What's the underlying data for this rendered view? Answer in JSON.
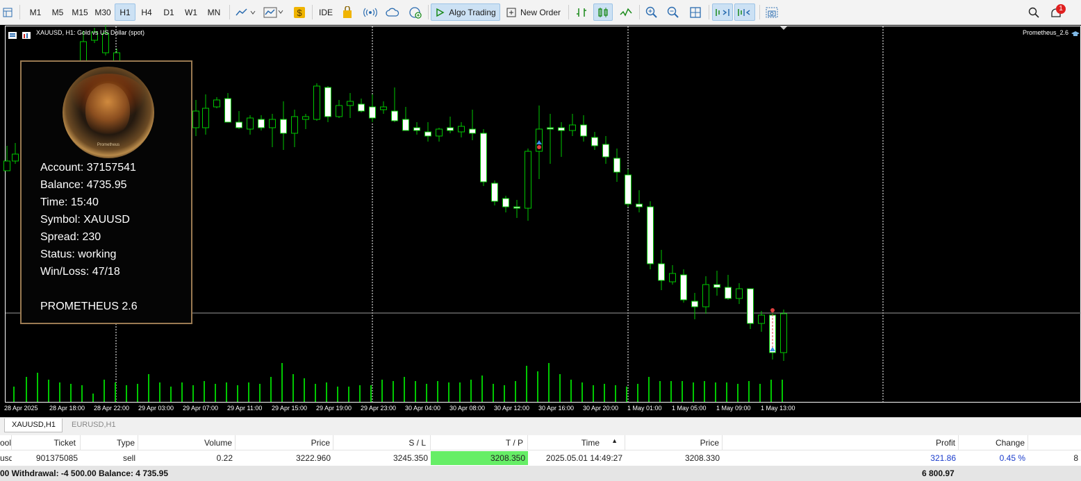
{
  "toolbar": {
    "timeframes": [
      "M1",
      "M5",
      "M15",
      "M30",
      "H1",
      "H4",
      "D1",
      "W1",
      "MN"
    ],
    "active_timeframe": "H1",
    "ide_label": "IDE",
    "algo_trading_label": "Algo Trading",
    "new_order_label": "New Order",
    "notification_count": "1"
  },
  "chart": {
    "title": "XAUUSD, H1:  Gold vs US Dollar (spot)",
    "ea_label": "Prometheus_2.6",
    "x_labels": [
      "28 Apr 2025",
      "28 Apr 18:00",
      "28 Apr 22:00",
      "29 Apr 03:00",
      "29 Apr 07:00",
      "29 Apr 11:00",
      "29 Apr 15:00",
      "29 Apr 19:00",
      "29 Apr 23:00",
      "30 Apr 04:00",
      "30 Apr 08:00",
      "30 Apr 12:00",
      "30 Apr 16:00",
      "30 Apr 20:00",
      "1 May 01:00",
      "1 May 05:00",
      "1 May 09:00",
      "1 May 13:00"
    ],
    "colors": {
      "background": "#000000",
      "bull": "#000000",
      "bear": "#ffffff",
      "wick": "#00c800",
      "volume": "#00c800",
      "grid": "#ffffff"
    }
  },
  "panel": {
    "coin_text": "Prometheus",
    "lines": [
      "Account: 37157541",
      "Balance: 4735.95",
      "Time: 15:40",
      "Symbol: XAUUSD",
      "Spread: 230",
      "Status: working",
      "Win/Loss: 47/18",
      "PROMETHEUS  2.6"
    ]
  },
  "tabs": [
    "XAUUSD,H1",
    "EURUSD,H1"
  ],
  "table": {
    "headers": [
      "ool",
      "Ticket",
      "Type",
      "Volume",
      "Price",
      "S / L",
      "T / P",
      "Time",
      "Price",
      "Profit",
      "Change"
    ],
    "row": [
      "usd",
      "901375085",
      "sell",
      "0.22",
      "3222.960",
      "3245.350",
      "3208.350",
      "2025.05.01 14:49:27",
      "3208.330",
      "321.86",
      "0.45 %",
      "8"
    ],
    "colors": {
      "tp_highlight": "#66ee66",
      "profit": "#1a3ccc"
    }
  },
  "summary": {
    "left": "00  Withdrawal: -4 500.00  Balance: 4 735.95",
    "right": "6 800.97"
  }
}
